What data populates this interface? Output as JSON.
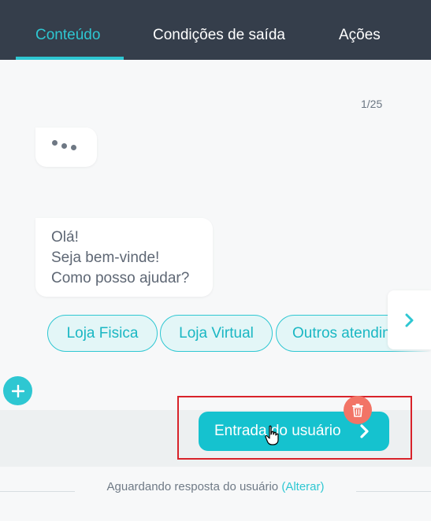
{
  "tabs": [
    {
      "label": "Conteúdo",
      "active": true
    },
    {
      "label": "Condições de saída",
      "active": false
    },
    {
      "label": "Ações",
      "active": false
    }
  ],
  "card_counter": "1/25",
  "bot_message": {
    "lines": [
      "Olá!",
      "Seja bem-vinde!",
      "Como posso ajudar?"
    ]
  },
  "quick_replies": [
    "Loja Fisica",
    "Loja Virtual",
    "Outros atendimentos"
  ],
  "user_input_button": {
    "label": "Entrada do usuário",
    "icon": "chevron-right-icon"
  },
  "icons": {
    "typing": "typing-indicator-icon",
    "next": "chevron-right-icon",
    "add": "plus-icon",
    "delete": "trash-icon",
    "cursor": "hand-pointer-cursor"
  },
  "footer": {
    "status": "Aguardando resposta do usuário",
    "link_label": "(Alterar)"
  },
  "colors": {
    "header_bg": "#353e4b",
    "accent": "#2ec7d2",
    "primary_button": "#15c2cf",
    "delete_button": "#f27466",
    "highlight_border": "#d8232a"
  }
}
